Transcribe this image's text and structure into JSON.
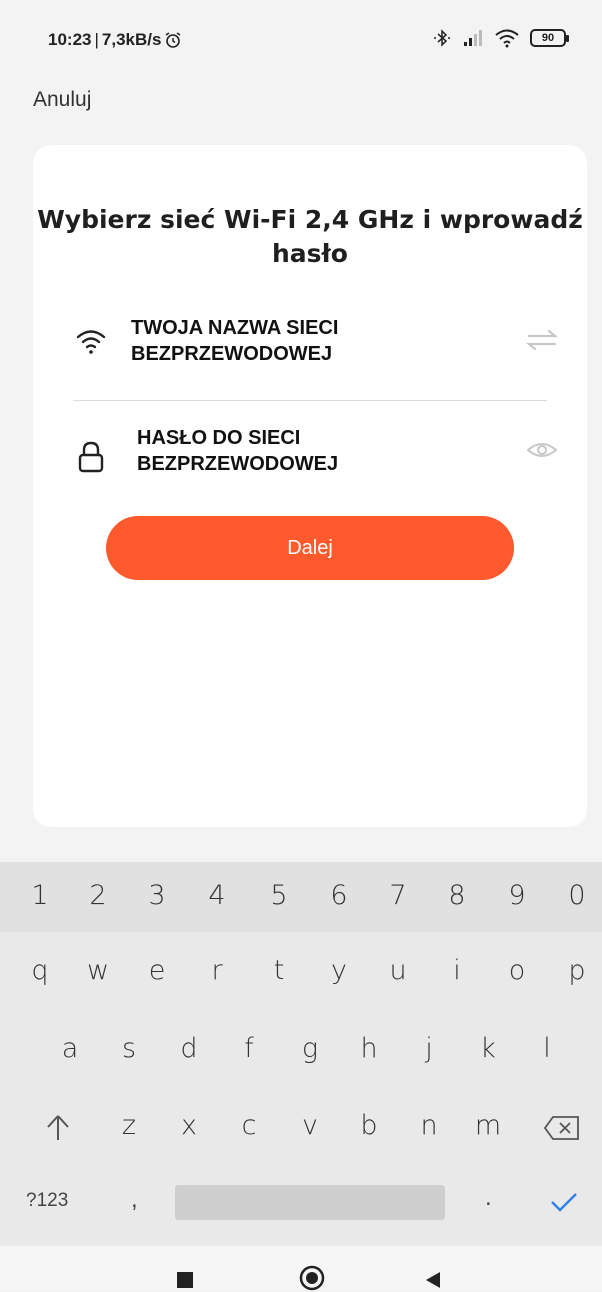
{
  "status_bar": {
    "time": "10:23",
    "separator": "|",
    "speed": "7,3kB/s",
    "battery": "90"
  },
  "header": {
    "cancel_label": "Anuluj"
  },
  "card": {
    "title": "Wybierz sieć Wi-Fi 2,4 GHz i wprowadź hasło",
    "ssid_value": "TWOJA NAZWA SIECI BEZPRZEWODOWEJ",
    "password_value": "HASŁO DO SIECI BEZPRZEWODOWEJ",
    "next_label": "Dalej"
  },
  "keyboard": {
    "numbers": [
      "1",
      "2",
      "3",
      "4",
      "5",
      "6",
      "7",
      "8",
      "9",
      "0"
    ],
    "row1": [
      "q",
      "w",
      "e",
      "r",
      "t",
      "y",
      "u",
      "i",
      "o",
      "p"
    ],
    "row2": [
      "a",
      "s",
      "d",
      "f",
      "g",
      "h",
      "j",
      "k",
      "l"
    ],
    "row3": [
      "z",
      "x",
      "c",
      "v",
      "b",
      "n",
      "m"
    ],
    "symbols_label": "?123",
    "comma": ",",
    "period": "."
  },
  "colors": {
    "accent": "#ff5a2e",
    "card": "#ffffff",
    "background": "#f3f3f3"
  }
}
